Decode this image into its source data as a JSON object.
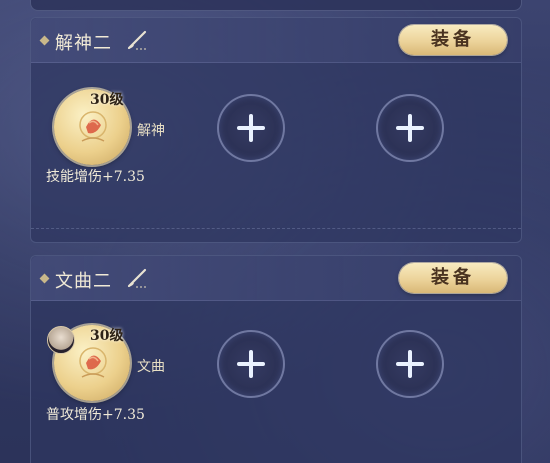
{
  "colors": {
    "background": "#2f3760",
    "panel": "#2e3660",
    "gold_button": "#ecd39a",
    "gold_text": "#4a3320",
    "title_text": "#f1ead6"
  },
  "icons": {
    "brush": "brush-icon",
    "add": "plus-icon",
    "emblem": "skill-emblem-icon"
  },
  "panels": [
    {
      "title": "解神二",
      "equip_label": "装备",
      "skill": {
        "level": "30级",
        "name": "解神",
        "bonus": "技能增伤+7.35",
        "has_avatar": false
      },
      "empty_slots": 2
    },
    {
      "title": "文曲二",
      "equip_label": "装备",
      "skill": {
        "level": "30级",
        "name": "文曲",
        "bonus": "普攻增伤+7.35",
        "has_avatar": true
      },
      "empty_slots": 2
    }
  ]
}
